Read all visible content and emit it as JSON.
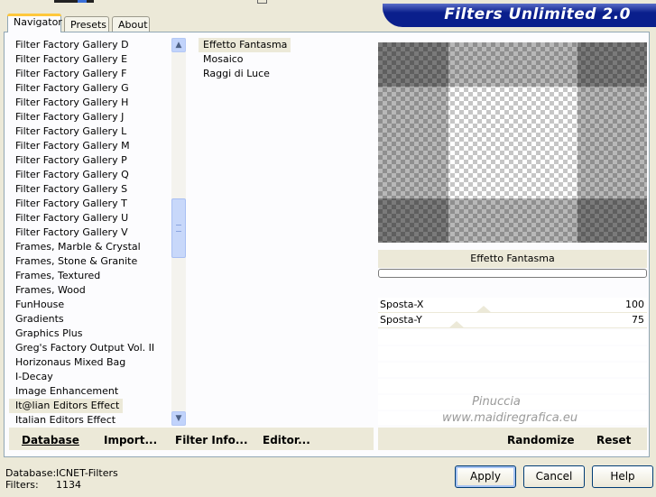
{
  "banner": {
    "title": "Filters Unlimited 2.0"
  },
  "tabs": [
    {
      "label": "Navigator",
      "active": true
    },
    {
      "label": "Presets",
      "active": false
    },
    {
      "label": "About",
      "active": false
    }
  ],
  "filter_list": [
    "Filter Factory Gallery D",
    "Filter Factory Gallery E",
    "Filter Factory Gallery F",
    "Filter Factory Gallery G",
    "Filter Factory Gallery H",
    "Filter Factory Gallery J",
    "Filter Factory Gallery L",
    "Filter Factory Gallery M",
    "Filter Factory Gallery P",
    "Filter Factory Gallery Q",
    "Filter Factory Gallery S",
    "Filter Factory Gallery T",
    "Filter Factory Gallery U",
    "Filter Factory Gallery V",
    "Frames, Marble & Crystal",
    "Frames, Stone & Granite",
    "Frames, Textured",
    "Frames, Wood",
    "FunHouse",
    "Gradients",
    "Graphics Plus",
    "Greg's Factory Output Vol. II",
    "Horizonaus Mixed Bag",
    "I-Decay",
    "Image Enhancement",
    "It@lian Editors Effect",
    "Italian Editors Effect"
  ],
  "selected_filter": "It@lian Editors Effect",
  "effect_list": [
    "Effetto Fantasma",
    "Mosaico",
    "Raggi di Luce"
  ],
  "selected_effect": "Effetto Fantasma",
  "preview": {
    "effect_name": "Effetto Fantasma"
  },
  "sliders": [
    {
      "label": "Sposta-X",
      "value": 100
    },
    {
      "label": "Sposta-Y",
      "value": 75
    }
  ],
  "watermark": {
    "line1": "Pinuccia",
    "line2": "www.maidiregrafica.eu"
  },
  "toolbar": {
    "database": "Database",
    "import": "Import...",
    "filter_info": "Filter Info...",
    "editor": "Editor...",
    "randomize": "Randomize",
    "reset": "Reset"
  },
  "status": {
    "database_label": "Database:",
    "database_value": "ICNET-Filters",
    "filters_label": "Filters:",
    "filters_value": "1134"
  },
  "buttons": {
    "apply": "Apply",
    "cancel": "Cancel",
    "help": "Help"
  }
}
